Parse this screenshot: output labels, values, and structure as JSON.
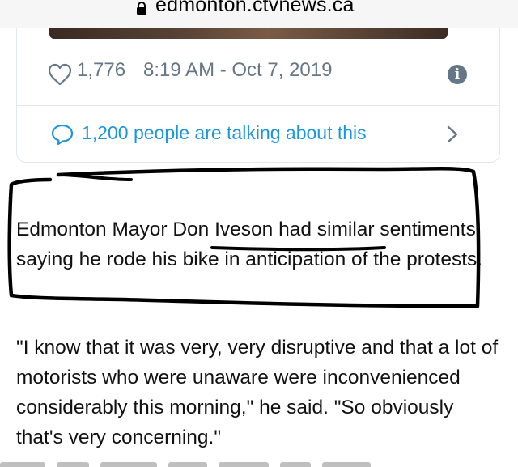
{
  "browser": {
    "url_domain": "edmonton.ctvnews.ca",
    "lock_icon": "lock-icon"
  },
  "tweet": {
    "like_count": "1,776",
    "timestamp": "8:19 AM - Oct 7, 2019",
    "info_glyph": "i",
    "talking": "1,200 people are talking about this",
    "colors": {
      "link": "#1b95e0",
      "meta": "#657786",
      "border": "#e1e8ed"
    }
  },
  "article": {
    "para1": "Edmonton Mayor Don Iveson had similar sentiments, saying he rode his bike in anticipation of the protests.",
    "para2": "\"I know that it was very, very disruptive and that a lot of motorists who were unaware were inconvenienced considerably this morning,\" he said. \"So obviously that's very concerning.\""
  },
  "annotation": {
    "marker_color": "#000000"
  }
}
